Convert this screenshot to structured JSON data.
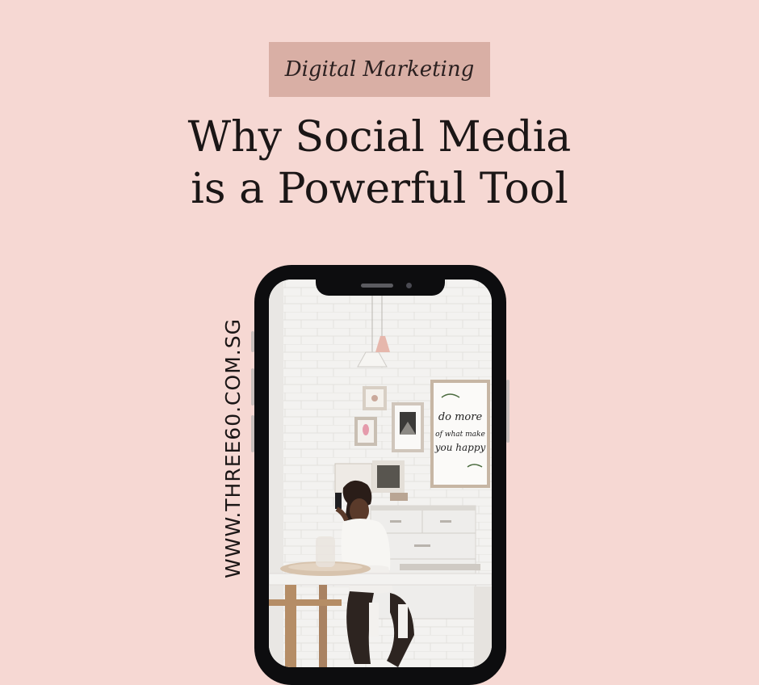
{
  "category_tag": "Digital Marketing",
  "headline": {
    "line1": "Why Social Media",
    "line2": "is a Powerful Tool"
  },
  "website_url": "WWW.THREE60.COM.SG",
  "poster_script": {
    "line1": "do more",
    "line2": "of what make",
    "line3": "you happy"
  },
  "colors": {
    "background": "#f6d8d3",
    "tag_background": "#d9afa5",
    "text": "#1b1616",
    "phone_body": "#0d0d0f"
  }
}
